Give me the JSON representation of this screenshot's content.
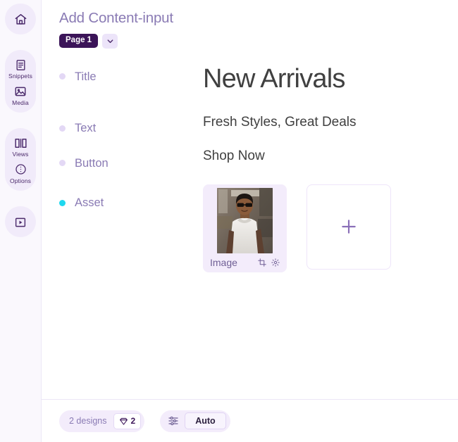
{
  "rail": {
    "groups": [
      {
        "items": [
          {
            "icon": "home-icon",
            "label": ""
          }
        ]
      },
      {
        "items": [
          {
            "icon": "snippets-icon",
            "label": "Snippets"
          },
          {
            "icon": "media-icon",
            "label": "Media"
          }
        ]
      },
      {
        "items": [
          {
            "icon": "views-icon",
            "label": "Views"
          },
          {
            "icon": "options-icon",
            "label": "Options"
          }
        ]
      },
      {
        "items": [
          {
            "icon": "play-icon",
            "label": ""
          }
        ]
      }
    ]
  },
  "header": {
    "title": "Add Content-input",
    "page_chip": "Page 1",
    "page_dropdown_icon": "chevron-down-icon"
  },
  "fields": [
    {
      "label": "Title",
      "active": false
    },
    {
      "label": "Text",
      "active": false
    },
    {
      "label": "Button",
      "active": false
    },
    {
      "label": "Asset",
      "active": true
    }
  ],
  "content": {
    "headline": "New Arrivals",
    "subhead": "Fresh Styles, Great Deals",
    "cta": "Shop Now"
  },
  "assets": {
    "image_card": {
      "name": "Image",
      "crop_icon": "crop-icon",
      "settings_icon": "gear-icon"
    },
    "add_card": {
      "icon": "plus-icon"
    }
  },
  "bottombar": {
    "designs_label": "2 designs",
    "designs_count": "2",
    "designs_icon": "diamond-icon",
    "sliders_icon": "sliders-icon",
    "auto_label": "Auto"
  },
  "colors": {
    "accent_active_dot": "#1fd8ef",
    "brand_dark": "#3b1458",
    "brand_light": "#f3ecfb",
    "muted_text": "#8a7bb4"
  }
}
